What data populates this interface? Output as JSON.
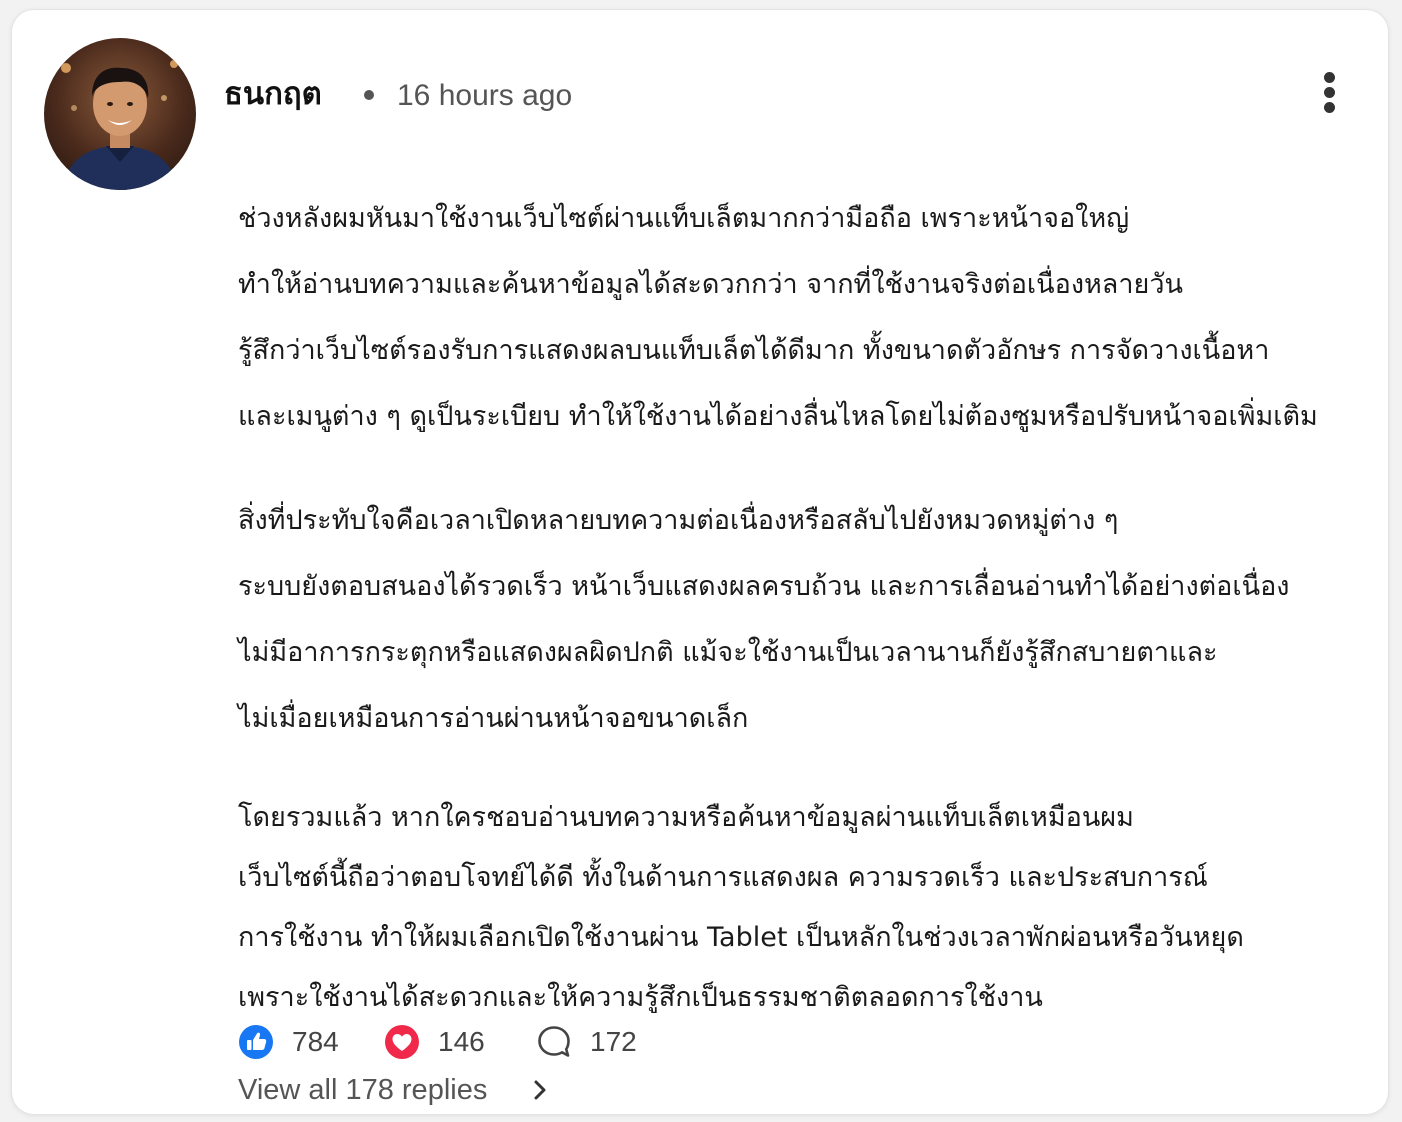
{
  "comment": {
    "author": "ธนกฤต",
    "avatar_icon": "profile-photo-icon",
    "timestamp": "16 hours ago",
    "more_icon": "more-vertical-icon",
    "body": {
      "paragraph_1": [
        "ช่วงหลังผมหันมาใช้งานเว็บไซต์ผ่านแท็บเล็ตมากกว่ามือถือ เพราะหน้าจอใหญ่",
        "ทำให้อ่านบทความและค้นหาข้อมูลได้สะดวกกว่า จากที่ใช้งานจริงต่อเนื่องหลายวัน",
        "รู้สึกว่าเว็บไซต์รองรับการแสดงผลบนแท็บเล็ตได้ดีมาก ทั้งขนาดตัวอักษร การจัดวางเนื้อหา",
        "และเมนูต่าง ๆ ดูเป็นระเบียบ ทำให้ใช้งานได้อย่างลื่นไหลโดยไม่ต้องซูมหรือปรับหน้าจอเพิ่มเติม"
      ],
      "paragraph_2": [
        "สิ่งที่ประทับใจคือเวลาเปิดหลายบทความต่อเนื่องหรือสลับไปยังหมวดหมู่ต่าง ๆ",
        "ระบบยังตอบสนองได้รวดเร็ว หน้าเว็บแสดงผลครบถ้วน และการเลื่อนอ่านทำได้อย่างต่อเนื่อง",
        "ไม่มีอาการกระตุกหรือแสดงผลผิดปกติ แม้จะใช้งานเป็นเวลานานก็ยังรู้สึกสบายตาและ",
        "ไม่เมื่อยเหมือนการอ่านผ่านหน้าจอขนาดเล็ก"
      ],
      "paragraph_3": [
        "โดยรวมแล้ว หากใครชอบอ่านบทความหรือค้นหาข้อมูลผ่านแท็บเล็ตเหมือนผม",
        "เว็บไซต์นี้ถือว่าตอบโจทย์ได้ดี ทั้งในด้านการแสดงผล ความรวดเร็ว และประสบการณ์",
        "การใช้งาน ทำให้ผมเลือกเปิดใช้งานผ่าน Tablet เป็นหลักในช่วงเวลาพักผ่อนหรือวันหยุด",
        "เพราะใช้งานได้สะดวกและให้ความรู้สึกเป็นธรรมชาติตลอดการใช้งาน"
      ]
    },
    "reactions": {
      "like": {
        "icon": "thumbs-up-icon",
        "count": "784",
        "color": "#1877f2"
      },
      "love": {
        "icon": "heart-icon",
        "count": "146",
        "color": "#f0284a"
      },
      "replies": {
        "icon": "comment-bubble-icon",
        "count": "172"
      }
    },
    "view_replies": {
      "label": "View all 178 replies",
      "icon": "chevron-right-icon"
    }
  }
}
